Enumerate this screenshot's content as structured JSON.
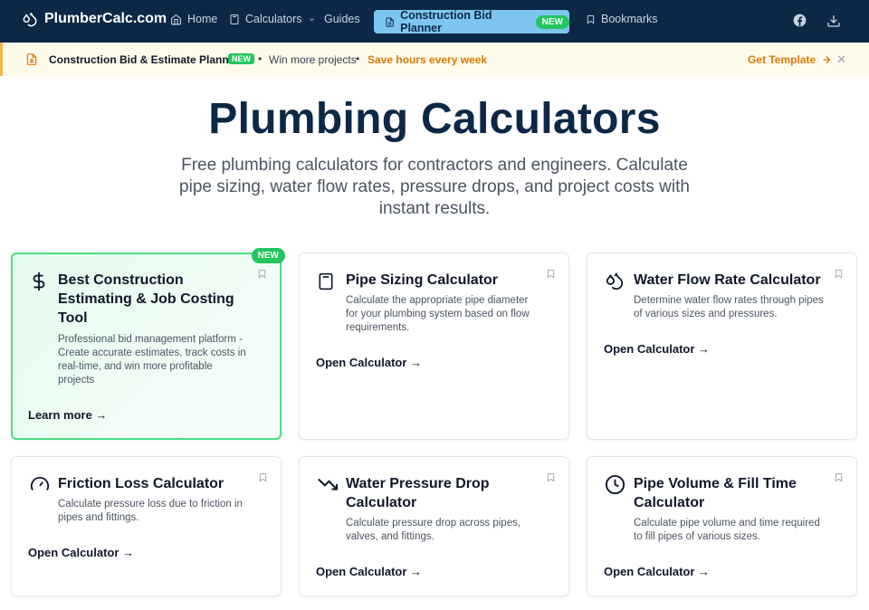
{
  "nav": {
    "brand": "PlumberCalc.com",
    "links": [
      {
        "label": "Home",
        "icon": "home-icon"
      },
      {
        "label": "Calculators",
        "icon": "calculator-icon"
      },
      {
        "label": "Guides"
      },
      {
        "label": "Bookmarks",
        "icon": "bookmark-icon"
      }
    ],
    "cta": {
      "label": "Construction Bid Planner",
      "badge": "NEW"
    }
  },
  "banner": {
    "title": "Construction Bid & Estimate Planner",
    "badge": "NEW",
    "separator": "•",
    "text": "Win more projects",
    "highlight": "Save hours every week",
    "cta": "Get Template",
    "close": "✕"
  },
  "hero": {
    "title": "Plumbing Calculators",
    "subtitle": "Free plumbing calculators for contractors and engineers. Calculate pipe sizing, water flow rates, pressure drops, and project costs with instant results."
  },
  "cards": [
    {
      "title": "Best Construction Estimating & Job Costing Tool",
      "description": "Professional bid management platform - Create accurate estimates, track costs in real-time, and win more profitable projects",
      "link": "Learn more →",
      "badge": "NEW",
      "icon": "dollar-icon"
    },
    {
      "title": "Pipe Sizing Calculator",
      "description": "Calculate the appropriate pipe diameter for your plumbing system based on flow requirements.",
      "link": "Open Calculator →",
      "icon": "calculator-icon"
    },
    {
      "title": "Water Flow Rate Calculator",
      "description": "Determine water flow rates through pipes of various sizes and pressures.",
      "link": "Open Calculator →",
      "icon": "droplets-icon"
    },
    {
      "title": "Friction Loss Calculator",
      "description": "Calculate pressure loss due to friction in pipes and fittings.",
      "link": "Open Calculator →",
      "icon": "gauge-icon"
    },
    {
      "title": "Water Pressure Drop Calculator",
      "description": "Calculate pressure drop across pipes, valves, and fittings.",
      "link": "Open Calculator →",
      "icon": "trending-down-icon"
    },
    {
      "title": "Pipe Volume & Fill Time Calculator",
      "description": "Calculate pipe volume and time required to fill pipes of various sizes.",
      "link": "Open Calculator →",
      "icon": "clock-icon"
    }
  ],
  "colors": {
    "nav_bg": "#0d2847",
    "cta_bg": "#7cc6f0",
    "accent_green": "#22c55e",
    "banner_accent": "#d97706"
  }
}
